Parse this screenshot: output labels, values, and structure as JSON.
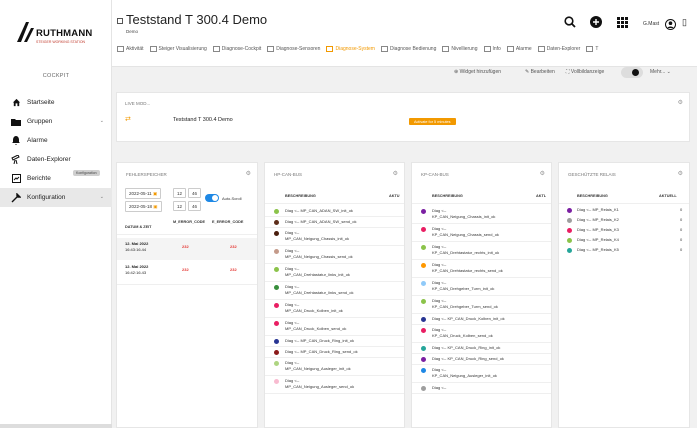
{
  "sidebar": {
    "brand": "RUTHMANN",
    "brand_sub": "STEIGER WORKING STATION",
    "section": "COCKPIT",
    "items": [
      {
        "label": "Startseite",
        "icon": "home-icon"
      },
      {
        "label": "Gruppen",
        "icon": "folder-icon"
      },
      {
        "label": "Alarme",
        "icon": "bell-icon"
      },
      {
        "label": "Daten-Explorer",
        "icon": "telescope-icon"
      },
      {
        "label": "Berichte",
        "icon": "report-icon"
      },
      {
        "label": "Konfiguration",
        "icon": "tools-icon"
      }
    ],
    "config_badge": "Konfiguration"
  },
  "header": {
    "title": "Teststand T 300.4 Demo",
    "subtitle": "Demo",
    "user": "G.Mast",
    "tabs": [
      {
        "label": "Aktivität"
      },
      {
        "label": "Steiger Visualisierung"
      },
      {
        "label": "Diagnose-Cockpit"
      },
      {
        "label": "Diagnose-Sensoren"
      },
      {
        "label": "Diagnose-System",
        "active": true
      },
      {
        "label": "Diagnose Bedienung"
      },
      {
        "label": "Nivellierung"
      },
      {
        "label": "Info"
      },
      {
        "label": "Alarme"
      },
      {
        "label": "Daten-Explorer"
      },
      {
        "label": "T"
      }
    ]
  },
  "toolbar": {
    "add_widget": "Widget hinzufügen",
    "edit": "Bearbeiten",
    "fullscreen": "Vollbildanzeige",
    "more": "Mehr..."
  },
  "live": {
    "label": "LIVE MOD...",
    "stand": "Teststand T 300.4 Demo",
    "activate": "Activate for 5 minutes"
  },
  "fehlerspeicher": {
    "title": "FEHLERSPEICHER",
    "from_date": "2022-05-11",
    "from_h": "12",
    "from_m": "46",
    "to_date": "2022-05-18",
    "to_h": "12",
    "to_m": "46",
    "auto": "Auto-Scroll",
    "columns": [
      "DATUM & ZEIT",
      "M_ERROR_CODE",
      "E_ERROR_CODE"
    ],
    "rows": [
      {
        "date": "12. Mai 2022",
        "time": "16:43:16.44",
        "m": "232",
        "e": "232"
      },
      {
        "date": "12. Mai 2022",
        "time": "16:42:16.43",
        "m": "232",
        "e": "232"
      }
    ]
  },
  "hp_canbus": {
    "title": "HP-CAN-BUS",
    "columns": [
      "BESCHREIBUNG",
      "AKTU"
    ],
    "rows": [
      {
        "l1": "Diag <-- MP_CAN_ADAN_SW_init_ok",
        "l2": "",
        "color": "#8bc34a"
      },
      {
        "l1": "Diag <-- MP_CAN_ADAN_SW_send_ok",
        "l2": "",
        "color": "#5d2e1a"
      },
      {
        "l1": "Diag <--",
        "l2": "MP_CAN_Neigung_Chassis_init_ok",
        "color": "#4a1e0e"
      },
      {
        "l1": "Diag <--",
        "l2": "MP_CAN_Neigung_Chassis_send_ok",
        "color": "#c49a8a"
      },
      {
        "l1": "Diag <--",
        "l2": "MP_CAN_Drehtastatur_links_init_ok",
        "color": "#8bc34a"
      },
      {
        "l1": "Diag <--",
        "l2": "MP_CAN_Drehtastatur_links_send_ok",
        "color": "#388e3c"
      },
      {
        "l1": "Diag <--",
        "l2": "MP_CAN_Druck_Kolben_init_ok",
        "color": "#e91e63"
      },
      {
        "l1": "Diag <--",
        "l2": "MP_CAN_Druck_Kolben_send_ok",
        "color": "#e91e63"
      },
      {
        "l1": "Diag <-- MP_CAN_Druck_Ring_init_ok",
        "l2": "",
        "color": "#283593"
      },
      {
        "l1": "Diag <-- MP_CAN_Druck_Ring_send_ok",
        "l2": "",
        "color": "#8b1a1a"
      },
      {
        "l1": "Diag <--",
        "l2": "MP_CAN_Neigung_Ausleger_init_ok",
        "color": "#aed581"
      },
      {
        "l1": "Diag <--",
        "l2": "MP_CAN_Neigung_Ausleger_send_ok",
        "color": "#f8bbd0"
      }
    ]
  },
  "kp_canbus": {
    "title": "KP-CAN-BUS",
    "columns": [
      "BESCHREIBUNG",
      "AKTL"
    ],
    "rows": [
      {
        "l1": "Diag <--",
        "l2": "KP_CAN_Neigung_Chassis_init_ok",
        "color": "#7b1fa2"
      },
      {
        "l1": "Diag <--",
        "l2": "KP_CAN_Neigung_Chassis_send_ok",
        "color": "#e91e63"
      },
      {
        "l1": "Diag <--",
        "l2": "KP_CAN_Drehtastatur_rechts_init_ok",
        "color": "#8bc34a"
      },
      {
        "l1": "Diag <--",
        "l2": "KP_CAN_Drehtastatur_rechts_send_ok",
        "color": "#ff9800"
      },
      {
        "l1": "Diag <--",
        "l2": "KP_CAN_Drehgeber_Turm_init_ok",
        "color": "#90caf9"
      },
      {
        "l1": "Diag <--",
        "l2": "KP_CAN_Drehgeber_Turm_send_ok",
        "color": "#8bc34a"
      },
      {
        "l1": "Diag <-- KP_CAN_Druck_Kolben_init_ok",
        "l2": "",
        "color": "#283593"
      },
      {
        "l1": "Diag <--",
        "l2": "KP_CAN_Druck_Kolben_send_ok",
        "color": "#e91e63"
      },
      {
        "l1": "Diag <-- KP_CAN_Druck_Ring_init_ok",
        "l2": "",
        "color": "#26a69a"
      },
      {
        "l1": "Diag <-- KP_CAN_Druck_Ring_send_ok",
        "l2": "",
        "color": "#7b1fa2"
      },
      {
        "l1": "Diag <--",
        "l2": "KP_CAN_Neigung_Ausleger_init_ok",
        "color": "#1e88e5"
      },
      {
        "l1": "Diag <--",
        "l2": "",
        "color": "#9e9e9e"
      }
    ]
  },
  "relais": {
    "title": "GESCHÜTZTE RELAIS",
    "columns": [
      "BESCHREIBUNG",
      "AKTUELL"
    ],
    "rows": [
      {
        "label": "Diag <-- MP_Relais_K1",
        "value": "0",
        "color": "#7b1fa2"
      },
      {
        "label": "Diag <-- MP_Relais_K2",
        "value": "0",
        "color": "#9e9e9e"
      },
      {
        "label": "Diag <-- MP_Relais_K3",
        "value": "0",
        "color": "#e91e63"
      },
      {
        "label": "Diag <-- MP_Relais_K4",
        "value": "0",
        "color": "#8bc34a"
      },
      {
        "label": "Diag <-- MP_Relais_K5",
        "value": "0",
        "color": "#26a69a"
      }
    ]
  }
}
